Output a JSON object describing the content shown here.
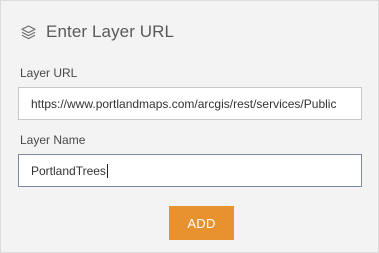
{
  "dialog": {
    "title": "Enter Layer URL",
    "icon": "layers-icon"
  },
  "layer_url": {
    "label": "Layer URL",
    "value": "https://www.portlandmaps.com/arcgis/rest/services/Public"
  },
  "layer_name": {
    "label": "Layer Name",
    "value": "PortlandTrees"
  },
  "add_button": {
    "label": "ADD"
  },
  "colors": {
    "accent": "#e8912f",
    "panel_bg": "#f3f3f3",
    "focus_border": "#7d8aa3"
  }
}
